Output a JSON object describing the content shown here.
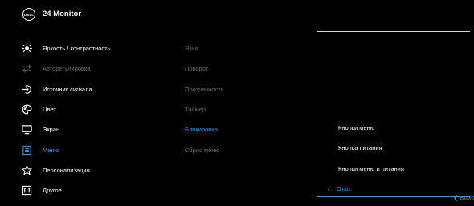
{
  "header": {
    "logo": "DELL",
    "title": "24 Monitor"
  },
  "main_menu": [
    {
      "label": "Яркость / контрастность",
      "icon": "brightness-icon",
      "state": "normal"
    },
    {
      "label": "Авторегулировка",
      "icon": "auto-adjust-icon",
      "state": "disabled"
    },
    {
      "label": "Источник сигнала",
      "icon": "input-source-icon",
      "state": "normal"
    },
    {
      "label": "Цвет",
      "icon": "color-palette-icon",
      "state": "normal"
    },
    {
      "label": "Экран",
      "icon": "display-icon",
      "state": "normal"
    },
    {
      "label": "Меню",
      "icon": "menu-icon",
      "state": "active"
    },
    {
      "label": "Персонализация",
      "icon": "star-icon",
      "state": "normal"
    },
    {
      "label": "Другое",
      "icon": "other-icon",
      "state": "normal"
    }
  ],
  "sub_menu": [
    {
      "label": "Язык",
      "state": "dim"
    },
    {
      "label": "Поворот",
      "state": "dim"
    },
    {
      "label": "Прозрачность",
      "state": "dim"
    },
    {
      "label": "Таймер",
      "state": "dim"
    },
    {
      "label": "Блокировка",
      "state": "active"
    },
    {
      "label": "Сброс меню",
      "state": "dim"
    }
  ],
  "options": [
    {
      "label": "Кнопки меню",
      "selected": false
    },
    {
      "label": "Кнопка питания",
      "selected": false
    },
    {
      "label": "Кнопки меню и питания",
      "selected": false
    },
    {
      "label": "Откл.",
      "selected": true
    }
  ],
  "exit_label": "❮ Выход",
  "colors": {
    "accent": "#3b95e0",
    "disabled": "#6b6b6b",
    "background": "#000000"
  }
}
